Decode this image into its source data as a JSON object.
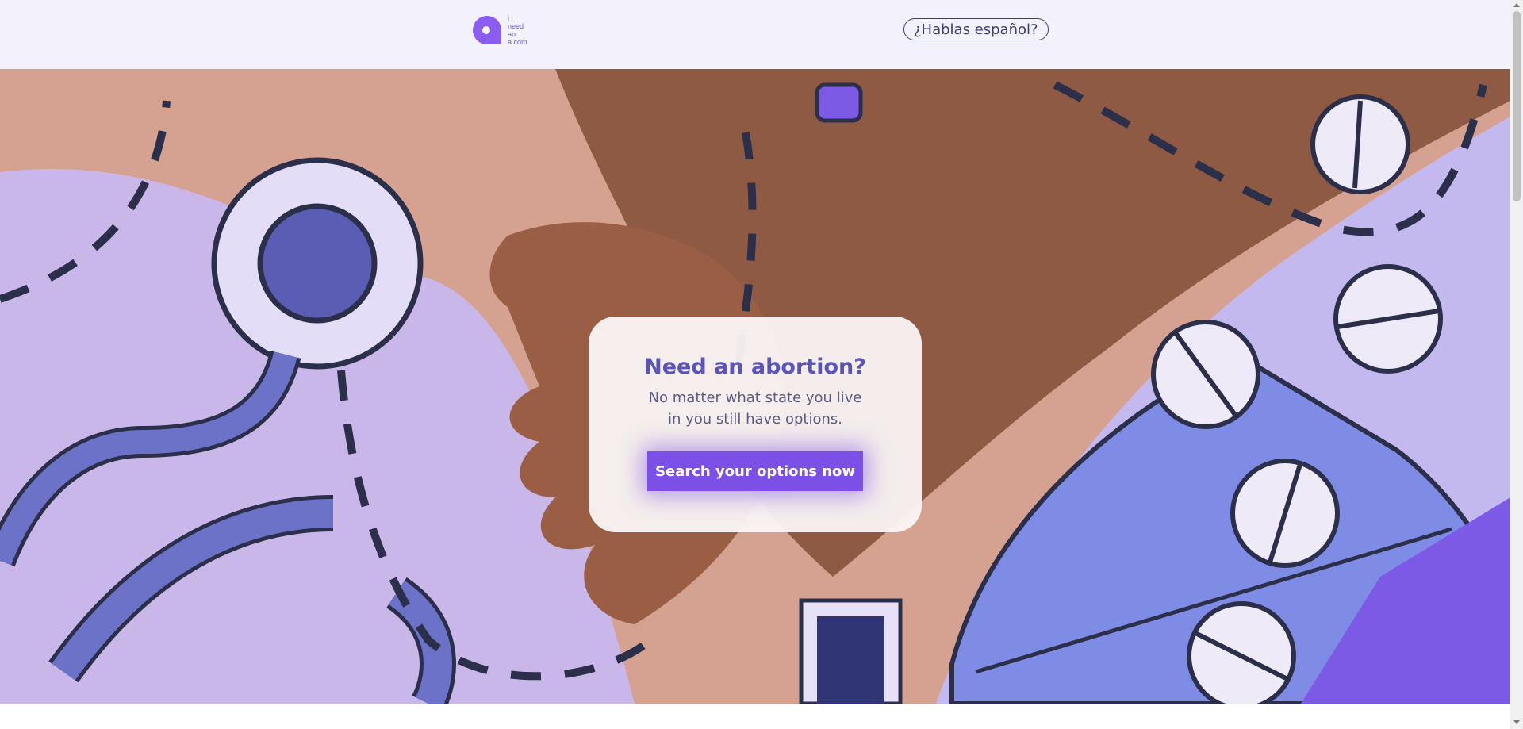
{
  "header": {
    "logo_lines": [
      "i",
      "need",
      "an",
      "a.com"
    ],
    "language_button": "¿Hablas español?"
  },
  "hero": {
    "heading": "Need an abortion?",
    "subtext": "No matter what state you live in you still have options.",
    "cta_label": "Search your options now"
  },
  "colors": {
    "brand_purple": "#7c4fe6",
    "heading_blue": "#5a55b8",
    "page_bg": "#f3f2fc"
  }
}
